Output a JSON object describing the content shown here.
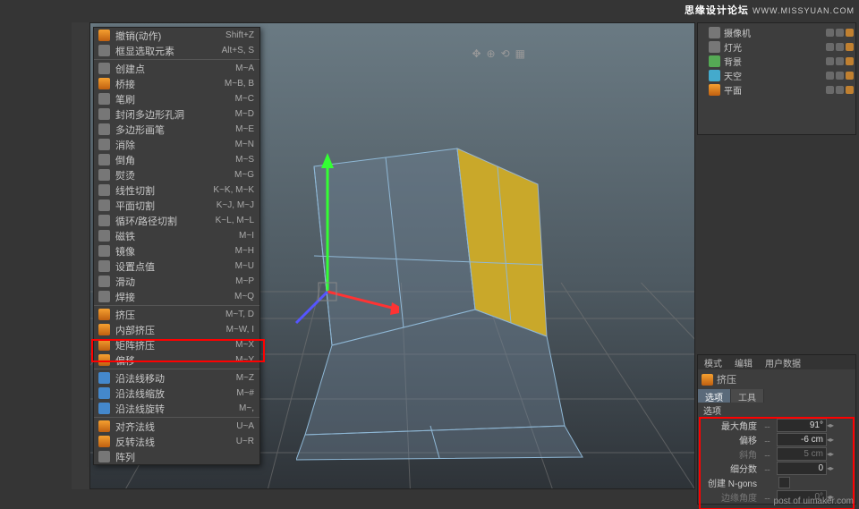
{
  "watermark": {
    "brand": "思缘设计论坛",
    "url": "WWW.MISSYUAN.COM",
    "footer": "post of uimaker.com"
  },
  "menu": [
    {
      "i": "org",
      "l": "撤销(动作)",
      "s": "Shift+Z"
    },
    {
      "i": "gry",
      "l": "框显选取元素",
      "s": "Alt+S, S"
    },
    {
      "sep": 1
    },
    {
      "i": "gry",
      "l": "创建点",
      "s": "M~A"
    },
    {
      "i": "org",
      "l": "桥接",
      "s": "M~B, B"
    },
    {
      "i": "gry",
      "l": "笔刷",
      "s": "M~C"
    },
    {
      "i": "gry",
      "l": "封闭多边形孔洞",
      "s": "M~D"
    },
    {
      "i": "gry",
      "l": "多边形画笔",
      "s": "M~E"
    },
    {
      "i": "gry",
      "l": "消除",
      "s": "M~N"
    },
    {
      "i": "gry",
      "l": "倒角",
      "s": "M~S"
    },
    {
      "i": "gry",
      "l": "熨烫",
      "s": "M~G"
    },
    {
      "i": "gry",
      "l": "线性切割",
      "s": "K~K, M~K"
    },
    {
      "i": "gry",
      "l": "平面切割",
      "s": "K~J, M~J"
    },
    {
      "i": "gry",
      "l": "循环/路径切割",
      "s": "K~L, M~L"
    },
    {
      "i": "gry",
      "l": "磁铁",
      "s": "M~I"
    },
    {
      "i": "gry",
      "l": "镜像",
      "s": "M~H"
    },
    {
      "i": "gry",
      "l": "设置点值",
      "s": "M~U"
    },
    {
      "i": "gry",
      "l": "滑动",
      "s": "M~P"
    },
    {
      "i": "gry",
      "l": "焊接",
      "s": "M~Q"
    },
    {
      "sep": 1
    },
    {
      "i": "org",
      "l": "挤压",
      "s": "M~T, D",
      "hl": 1
    },
    {
      "i": "org",
      "l": "内部挤压",
      "s": "M~W, I"
    },
    {
      "i": "org",
      "l": "矩阵挤压",
      "s": "M~X"
    },
    {
      "i": "org",
      "l": "偏移",
      "s": "M~Y"
    },
    {
      "sep": 1
    },
    {
      "i": "blu",
      "l": "沿法线移动",
      "s": "M~Z"
    },
    {
      "i": "blu",
      "l": "沿法线缩放",
      "s": "M~#"
    },
    {
      "i": "blu",
      "l": "沿法线旋转",
      "s": "M~,"
    },
    {
      "sep": 1
    },
    {
      "i": "org",
      "l": "对齐法线",
      "s": "U~A"
    },
    {
      "i": "org",
      "l": "反转法线",
      "s": "U~R"
    },
    {
      "i": "gry",
      "l": "阵列",
      "s": ""
    }
  ],
  "objects": [
    {
      "i": "gry",
      "n": "摄像机"
    },
    {
      "i": "gry",
      "n": "灯光"
    },
    {
      "i": "grn",
      "n": "背景"
    },
    {
      "i": "cyn",
      "n": "天空"
    },
    {
      "i": "org",
      "n": "平面"
    }
  ],
  "attr": {
    "tabs": [
      "模式",
      "编辑",
      "用户数据"
    ],
    "tool": "挤压",
    "subtabs": [
      "选项",
      "工具"
    ],
    "section": "选项",
    "rows": [
      {
        "l": "最大角度",
        "v": "91°"
      },
      {
        "l": "偏移",
        "v": "-6 cm"
      },
      {
        "l": "斜角",
        "v": "5 cm",
        "dis": 1
      },
      {
        "l": "细分数",
        "v": "0"
      },
      {
        "l": "创建 N-gons",
        "cb": 1
      },
      {
        "l": "边缘角度",
        "v": "0°",
        "dis": 1
      }
    ]
  }
}
